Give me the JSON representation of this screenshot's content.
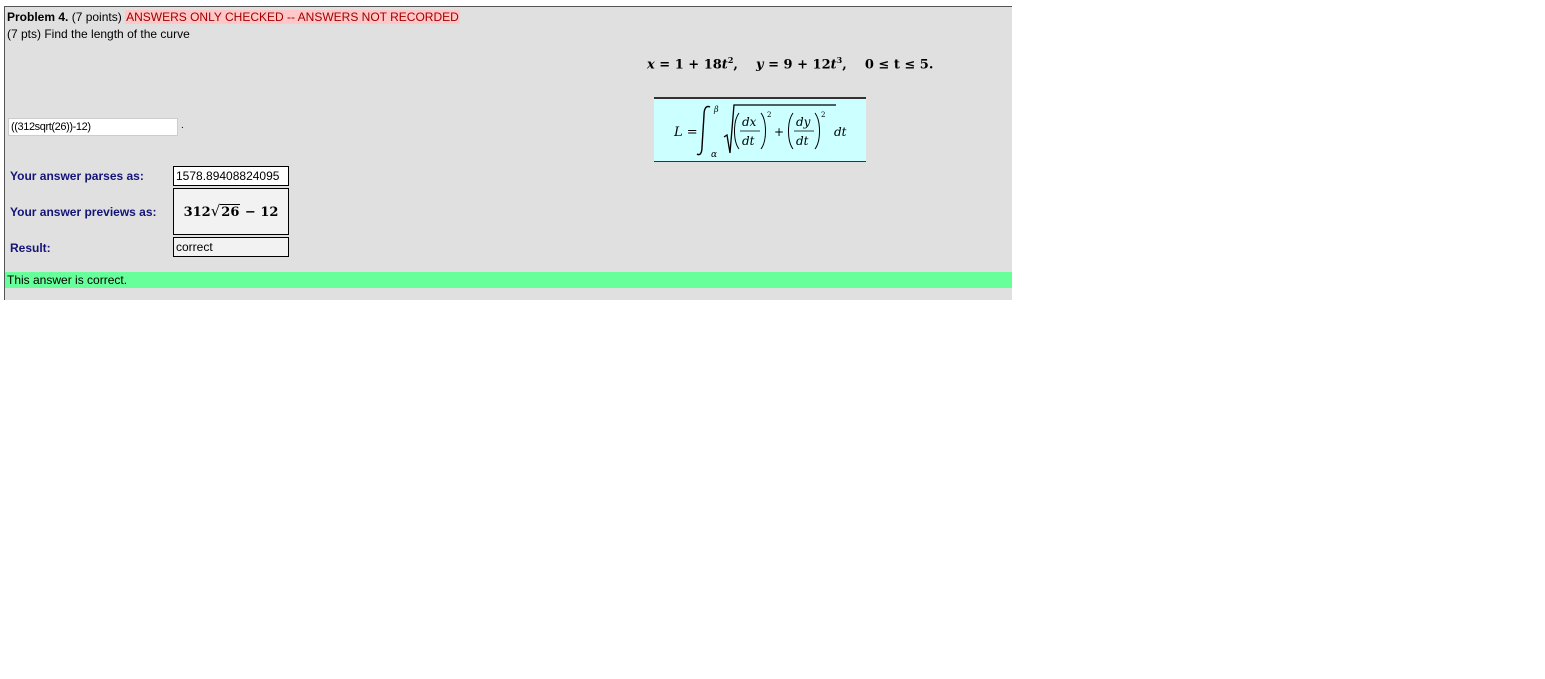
{
  "problem": {
    "number_label": "Problem 4.",
    "points": "(7 points)",
    "warning": "ANSWERS ONLY CHECKED -- ANSWERS NOT RECORDED",
    "question": "(7 pts) Find the length of the curve",
    "equation": {
      "x_part": "= 1 + 18",
      "y_part": "= 9 + 12",
      "range": "0 ≤ t ≤ 5."
    },
    "formula": {
      "lhs": "L =",
      "upper": "β",
      "lower": "α",
      "dx": "dx",
      "dy": "dy",
      "dt": "dt",
      "plus": "+",
      "tail": "dt"
    }
  },
  "answer": {
    "value": "((312sqrt(26))-12)",
    "trailing": "."
  },
  "results": {
    "parses_label": "Your answer parses as:",
    "parses_value": "1578.89408824095",
    "preview_label": "Your answer previews as:",
    "preview_coef": "312",
    "preview_radicand": "26",
    "preview_tail": "− 12",
    "result_label": "Result:",
    "result_value": "correct"
  },
  "status": {
    "message": "This answer is correct.",
    "color": "#66ff99"
  }
}
